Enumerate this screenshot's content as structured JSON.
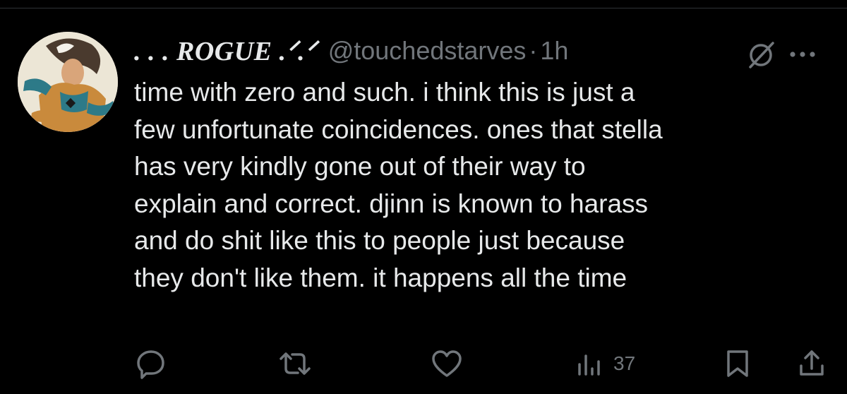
{
  "tweet": {
    "display_name": ". . . ROGUE .ᐟ.ᐟ",
    "handle": "@touchedstarves",
    "separator": "·",
    "time": "1h",
    "text": "time with zero and such. i think this is just a\nfew unfortunate coincidences. ones that stella\nhas very kindly gone out of their way to\nexplain and correct. djinn is known to harass\nand do shit like this to people just because\nthey don't like them. it happens all the time"
  },
  "actions": {
    "views_count": "37"
  },
  "icons": {
    "avatar": "avatar-image",
    "grok": "grok-icon",
    "more": "more-icon",
    "reply": "reply-icon",
    "retweet": "retweet-icon",
    "like": "like-icon",
    "views": "views-icon",
    "bookmark": "bookmark-icon",
    "share": "share-icon"
  },
  "colors": {
    "background": "#000000",
    "text_primary": "#e7e9ea",
    "text_secondary": "#71767b",
    "divider": "#2f3336"
  }
}
